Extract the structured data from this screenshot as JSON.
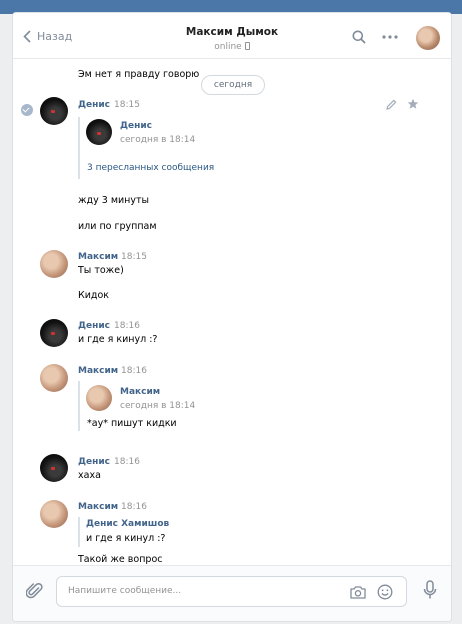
{
  "header": {
    "back_label": "Назад",
    "title": "Максим Дымок",
    "status": "online"
  },
  "history": {
    "top_partial_text": "Эм нет я правду говорю",
    "date_separator": "сегодня",
    "messages": [
      {
        "author": "Денис",
        "time": "18:15",
        "forward": {
          "author": "Денис",
          "time": "сегодня в 18:14",
          "link": "3 пересланных сообщения"
        },
        "lines": [
          "жду 3 минуты",
          "или по группам"
        ]
      },
      {
        "author": "Максим",
        "time": "18:15",
        "lines": [
          "Ты тоже)",
          "Кидок"
        ]
      },
      {
        "author": "Денис",
        "time": "18:16",
        "lines": [
          "и где я кинул :?"
        ]
      },
      {
        "author": "Максим",
        "time": "18:16",
        "forward": {
          "author": "Максим",
          "time": "сегодня в 18:14",
          "text": "*ау* пишут кидки"
        }
      },
      {
        "author": "Денис",
        "time": "18:16",
        "lines": [
          "хаха"
        ]
      },
      {
        "author": "Максим",
        "time": "18:16",
        "reply": {
          "author": "Денис Хамишов",
          "text": "и где я кинул :?"
        },
        "lines": [
          "Такой же вопрос"
        ]
      }
    ]
  },
  "composer": {
    "placeholder": "Напишите сообщение..."
  },
  "icons": [
    "chevron-left-icon",
    "search-icon",
    "more-icon",
    "pencil-icon",
    "star-icon",
    "check-icon",
    "paperclip-icon",
    "camera-icon",
    "emoji-icon",
    "microphone-icon",
    "phone-icon"
  ],
  "colors": {
    "accent": "#4a76a8",
    "link": "#2a5885",
    "author": "#42648b",
    "muted": "#939393",
    "background": "#edeef0"
  }
}
